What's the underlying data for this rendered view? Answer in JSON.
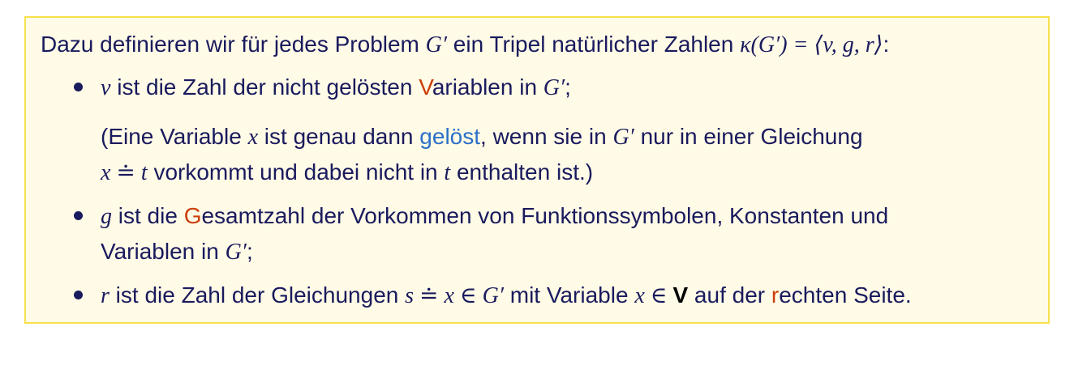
{
  "intro": {
    "t1": "Dazu definieren wir für jedes Problem ",
    "m1": "G′",
    "t2": " ein Tripel natürlicher Zahlen ",
    "m2": "κ(G′) = ⟨v, g, r⟩",
    "t3": ":"
  },
  "items": [
    {
      "var": "v",
      "t1": " ist die Zahl der nicht gelösten ",
      "hl": "V",
      "t2": "ariablen in ",
      "m1": "G′",
      "t3": ";"
    },
    {
      "var": "g",
      "t1": " ist die ",
      "hl": "G",
      "t2": "esamtzahl der Vorkommen von Funktionssymbolen, Konstanten und",
      "line2_t1": "Variablen in ",
      "line2_m1": "G′",
      "line2_t2": ";"
    },
    {
      "var": "r",
      "t1": " ist die Zahl der Gleichungen ",
      "m1": "s ≐ x ∈ G′",
      "t2": " mit Variable ",
      "m2": "x ∈ ",
      "bold": "V",
      "t3": " auf der ",
      "hl": "r",
      "t4": "echten Seite."
    }
  ],
  "note": {
    "t1": "(Eine Variable ",
    "m1": "x",
    "t2": " ist genau dann ",
    "hl": "gelöst",
    "t3": ", wenn sie in ",
    "m2": "G′",
    "t4": " nur in einer Gleichung",
    "line2_m1": "x ≐ t",
    "line2_t1": " vorkommt und dabei nicht in ",
    "line2_m2": "t",
    "line2_t2": " enthalten ist.)"
  },
  "colors": {
    "text": "#1a1a5e",
    "highlight_red": "#cc3d0a",
    "highlight_blue": "#2b6fc7",
    "box_background": "#fffbe6",
    "box_border": "#f7e14a"
  }
}
